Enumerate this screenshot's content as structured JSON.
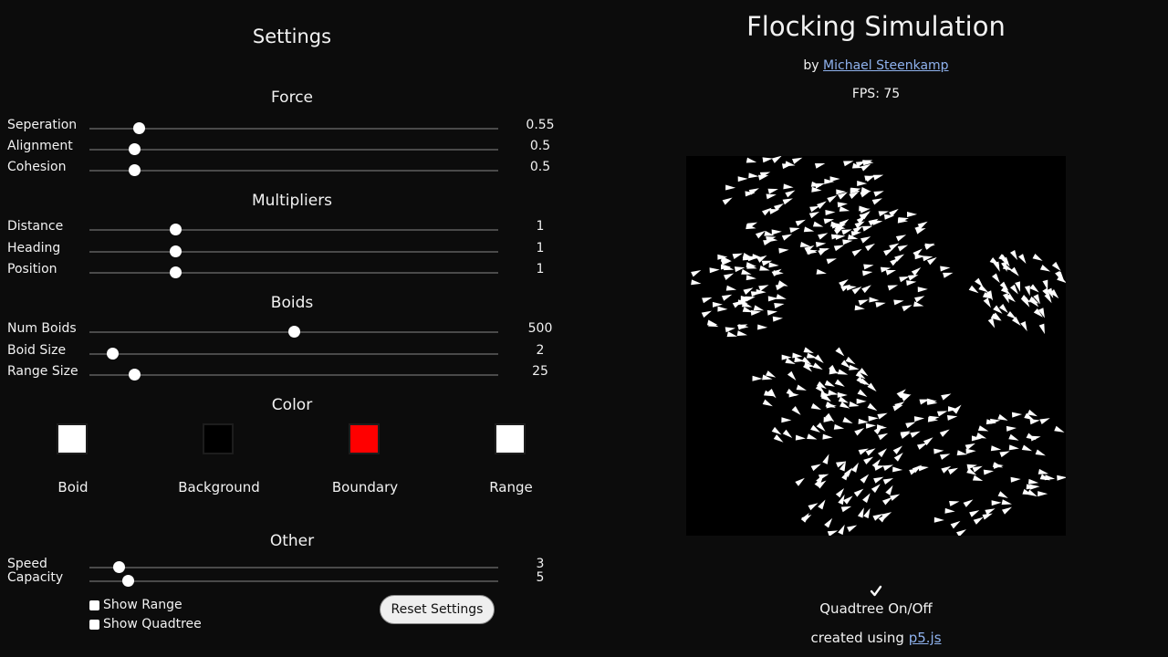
{
  "settings": {
    "title": "Settings",
    "sections": {
      "force": "Force",
      "multipliers": "Multipliers",
      "boids": "Boids",
      "color": "Color",
      "other": "Other"
    },
    "force": {
      "separation": {
        "label": "Seperation",
        "value": "0.55",
        "fraction": 0.12
      },
      "alignment": {
        "label": "Alignment",
        "value": "0.5",
        "fraction": 0.11
      },
      "cohesion": {
        "label": "Cohesion",
        "value": "0.5",
        "fraction": 0.11
      }
    },
    "multipliers": {
      "distance": {
        "label": "Distance",
        "value": "1",
        "fraction": 0.21
      },
      "heading": {
        "label": "Heading",
        "value": "1",
        "fraction": 0.21
      },
      "position": {
        "label": "Position",
        "value": "1",
        "fraction": 0.21
      }
    },
    "boids": {
      "num_boids": {
        "label": "Num Boids",
        "value": "500",
        "fraction": 0.5
      },
      "boid_size": {
        "label": "Boid Size",
        "value": "2",
        "fraction": 0.055
      },
      "range_size": {
        "label": "Range Size",
        "value": "25",
        "fraction": 0.11
      }
    },
    "colors": {
      "boid": {
        "label": "Boid",
        "value": "#ffffff"
      },
      "background": {
        "label": "Background",
        "value": "#000000"
      },
      "boundary": {
        "label": "Boundary",
        "value": "#ff0000"
      },
      "range": {
        "label": "Range",
        "value": "#ffffff"
      }
    },
    "other": {
      "speed": {
        "label": "Speed",
        "value": "3",
        "fraction": 0.072
      },
      "capacity": {
        "label": "Capacity",
        "value": "5",
        "fraction": 0.093
      }
    },
    "show_range": {
      "label": "Show Range",
      "checked": false
    },
    "show_quadtree": {
      "label": "Show Quadtree",
      "checked": false
    },
    "reset_label": "Reset Settings"
  },
  "header": {
    "title": "Flocking Simulation",
    "by": "by",
    "author": "Michael Steenkamp",
    "fps_label": "FPS: 75"
  },
  "simulation": {
    "background": "#000000",
    "boid_color": "#ffffff",
    "boid_count": 500
  },
  "footer": {
    "quadtree_label": "Quadtree On/Off",
    "quadtree_checked": true,
    "created_using": "created using",
    "library_link": "p5.js"
  }
}
